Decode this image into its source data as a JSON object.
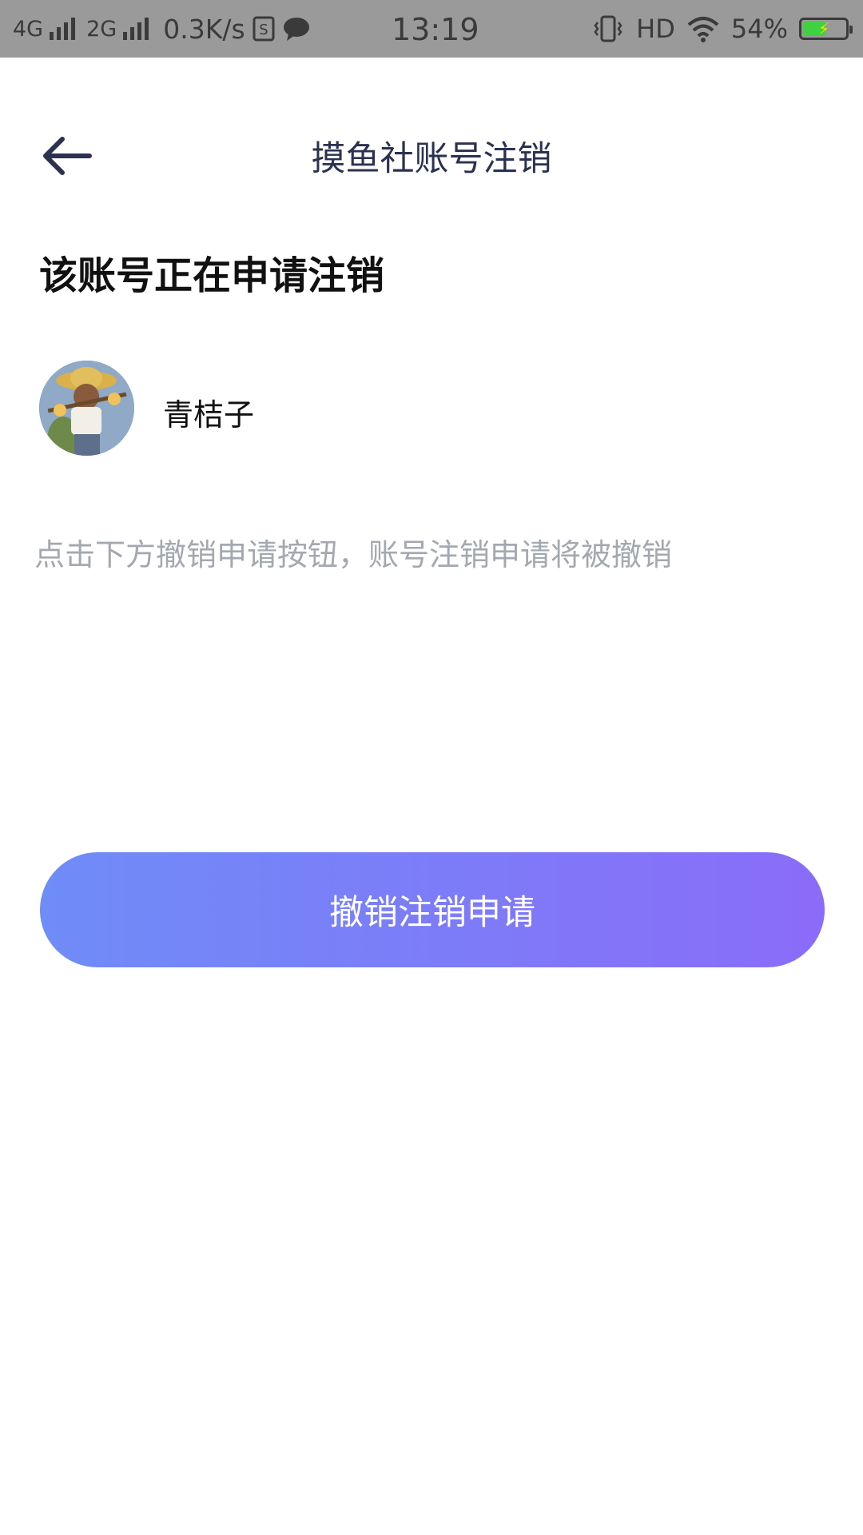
{
  "status_bar": {
    "net1": "4G",
    "net2": "2G",
    "speed": "0.3K/s",
    "time": "13:19",
    "hd": "HD",
    "battery_percent": "54%",
    "battery_level": 0.54,
    "icons": [
      "signal-icon",
      "signal-icon",
      "sim-icon",
      "chat-icon",
      "vibrate-icon",
      "wifi-icon",
      "battery-icon"
    ]
  },
  "header": {
    "title": "摸鱼社账号注销",
    "back_icon": "arrow-left-icon"
  },
  "main": {
    "heading": "该账号正在申请注销",
    "username": "青桔子",
    "hint": "点击下方撤销申请按钮，账号注销申请将被撤销",
    "button_label": "撤销注销申请"
  },
  "colors": {
    "title": "#2b3150",
    "hint": "#a4a8b0",
    "button_start": "#6f8cf7",
    "button_end": "#8a6cf9"
  }
}
